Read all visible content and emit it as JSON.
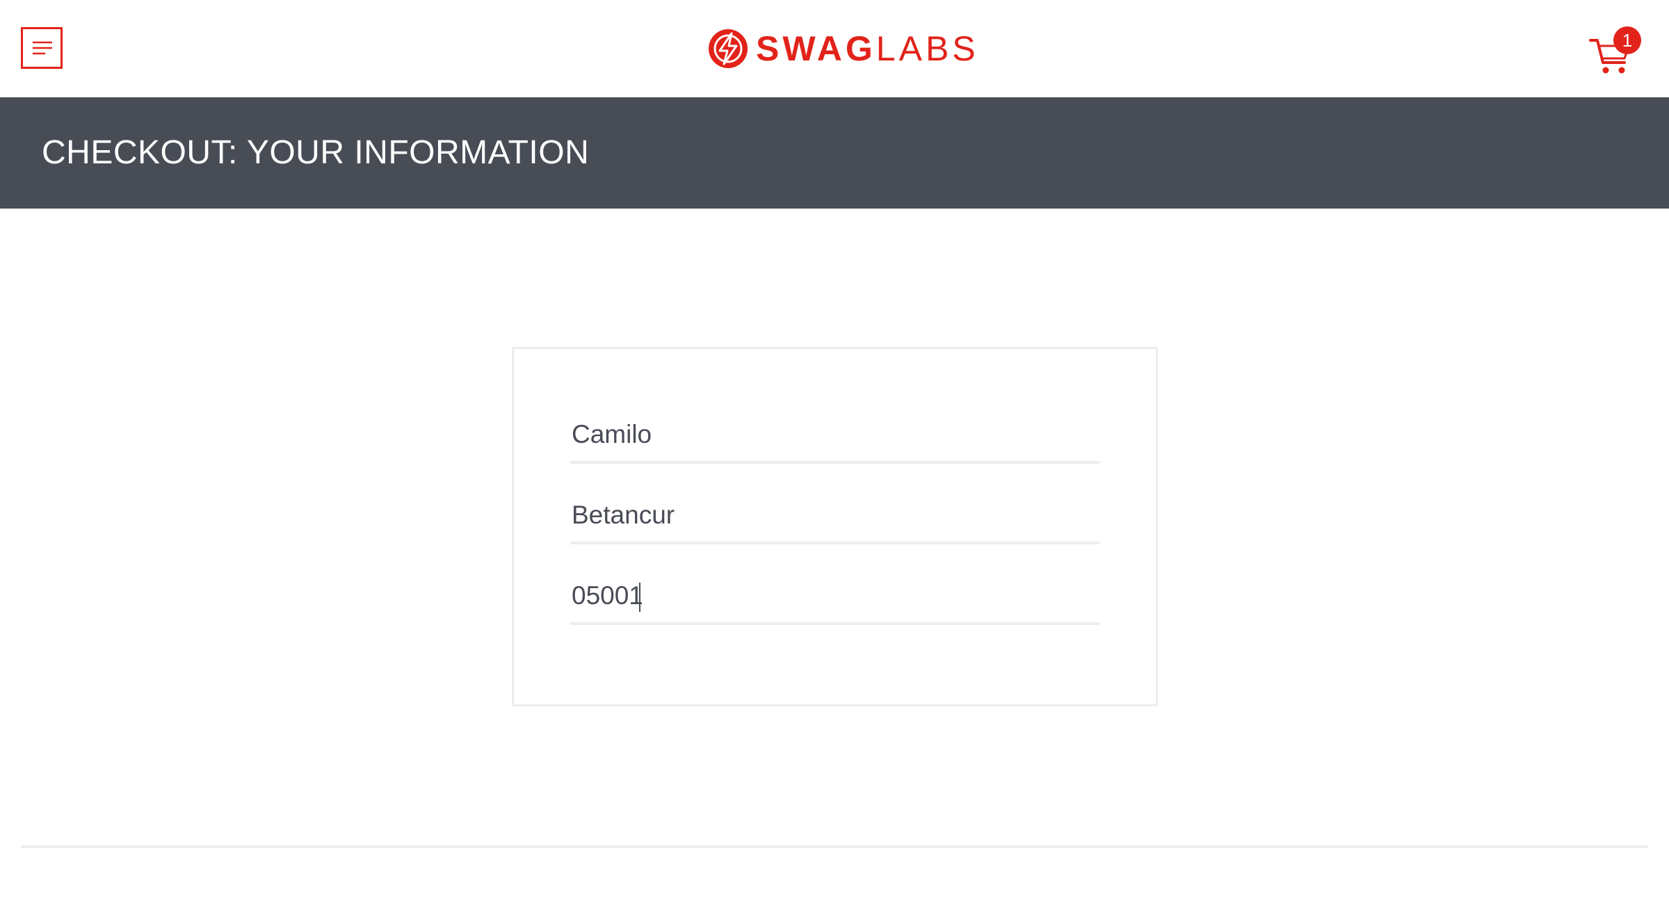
{
  "header": {
    "brand_primary": "SWAG",
    "brand_secondary": "LABS",
    "menu_icon": "hamburger-menu-icon",
    "cart_icon": "shopping-cart-icon",
    "cart_count": "1"
  },
  "subheader": {
    "title": "CHECKOUT: YOUR INFORMATION"
  },
  "form": {
    "first_name": "Camilo",
    "last_name": "Betancur",
    "postal_code": "05001"
  },
  "colors": {
    "accent": "#e2231a",
    "subheader_bg": "#484c55",
    "text": "#484c55",
    "border": "#ededed"
  }
}
